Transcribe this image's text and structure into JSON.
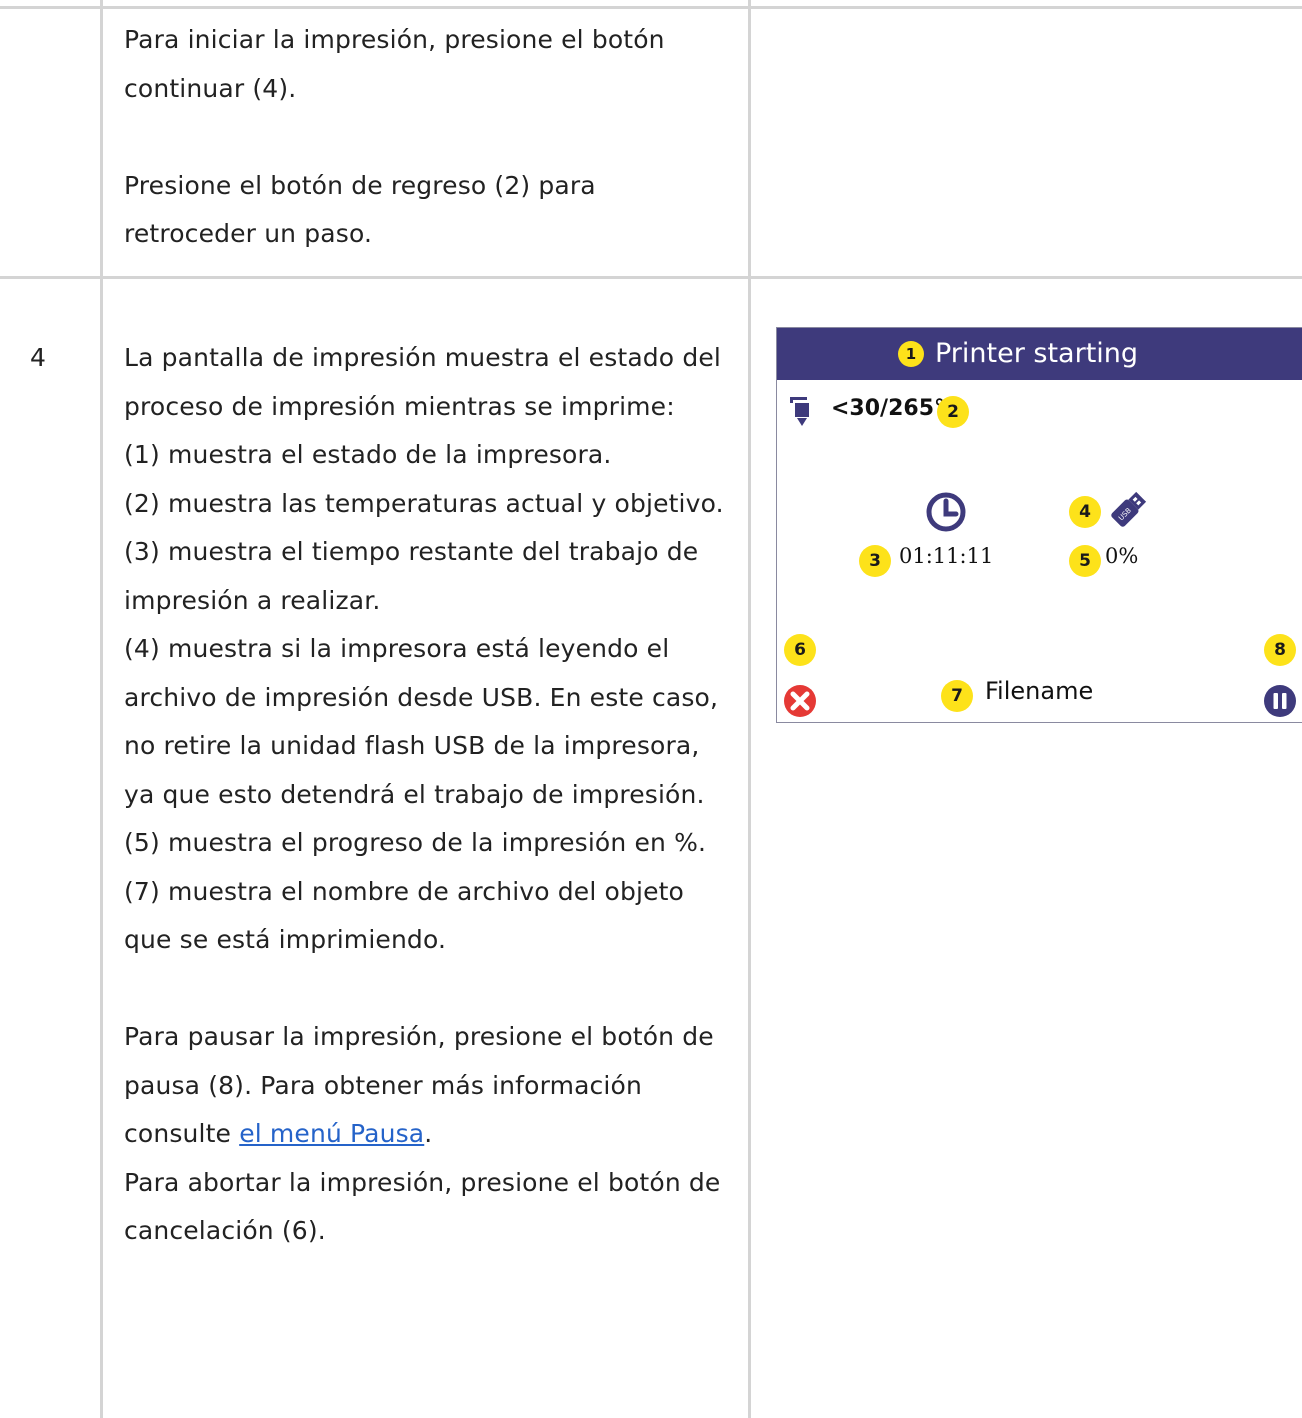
{
  "table": {
    "row_prev": {
      "paragraph1": "Para iniciar la impresión, presione el botón continuar (4).",
      "paragraph2": "Presione el botón de regreso (2) para retroceder un paso."
    },
    "row_step4": {
      "step_number": "4",
      "intro": "La pantalla de impresión muestra el estado del proceso de impresión mientras se imprime:",
      "items": [
        "(1) muestra el estado de la impresora.",
        "(2) muestra las temperaturas actual y objetivo.",
        "(3) muestra el tiempo restante del trabajo de impresión a realizar.",
        "(4) muestra si la impresora está leyendo el archivo de impresión desde USB. En este caso, no retire la unidad flash USB de la impresora, ya que esto detendrá el trabajo de impresión.",
        "(5) muestra el progreso de la impresión en %.",
        "(7) muestra el nombre de archivo del objeto que se está imprimiendo."
      ],
      "pause_prefix": "Para pausar la impresión, presione el botón de pausa (8). Para obtener más información consulte ",
      "pause_link": "el menú Pausa",
      "pause_suffix": ".",
      "abort_text": "Para abortar la impresión, presione el botón de cancelación (6)."
    }
  },
  "printer_screen": {
    "header_title": "Printer starting",
    "temperature": "<30/265°",
    "time_remaining": "01:11:11",
    "progress": "0%",
    "filename": "Filename",
    "badges": [
      "1",
      "2",
      "3",
      "4",
      "5",
      "6",
      "7",
      "8"
    ],
    "icons": [
      "extruder-icon",
      "clock-icon",
      "usb-icon",
      "cancel-icon",
      "pause-icon"
    ],
    "colors": {
      "header_bg": "#3e3a7c",
      "badge": "#fde21a",
      "cancel": "#e53935",
      "pause": "#3e3a7c"
    }
  }
}
